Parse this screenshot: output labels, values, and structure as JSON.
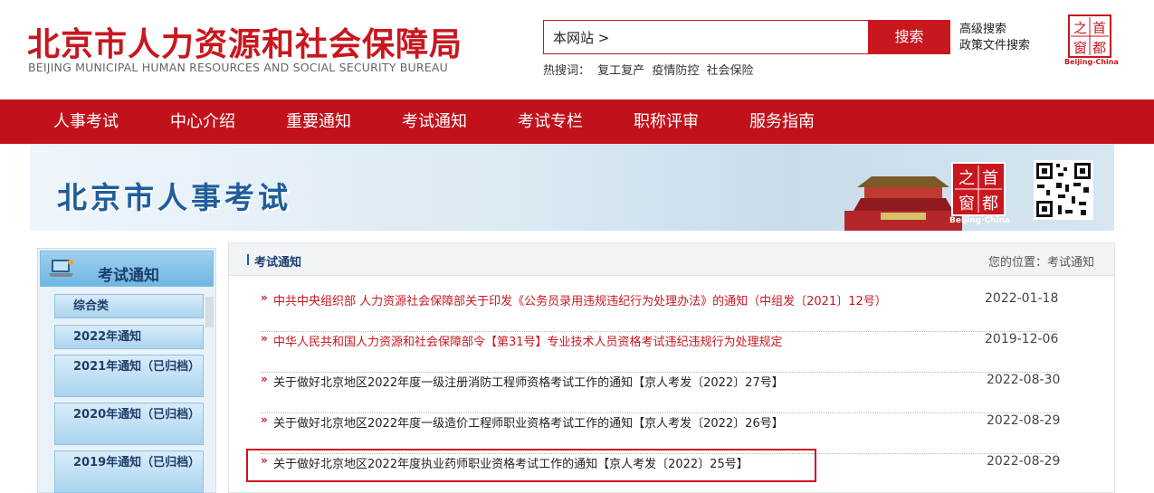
{
  "header": {
    "logo_cn": "北京市人力资源和社会保障局",
    "logo_en": "BEIJING MUNICIPAL HUMAN RESOURCES AND SOCIAL SECURITY BUREAU",
    "search_scope": "本网站 >",
    "search_button": "搜索",
    "advanced_search": "高级搜索",
    "policy_search": "政策文件搜索",
    "hot_label": "热搜词：",
    "hot_words": [
      "复工复产",
      "疫情防控",
      "社会保险"
    ],
    "seal_chars": [
      "之",
      "首",
      "窗",
      "都"
    ],
    "seal_caption": "Beijing-China"
  },
  "nav": {
    "items": [
      "人事考试",
      "中心介绍",
      "重要通知",
      "考试通知",
      "考试专栏",
      "职称评审",
      "服务指南"
    ]
  },
  "banner": {
    "title": "北京市人事考试",
    "seal_caption": "Beijing·China"
  },
  "sidebar": {
    "title": "考试通知",
    "items": [
      "综合类",
      "2022年通知",
      "2021年通知（已归档）",
      "2020年通知（已归档）",
      "2019年通知（已归档）"
    ]
  },
  "content": {
    "section_title": "考试通知",
    "breadcrumb": "您的位置：考试通知",
    "rows": [
      {
        "title": "中共中央组织部 人力资源社会保障部关于印发《公务员录用违规违纪行为处理办法》的通知（中组发〔2021〕12号）",
        "date": "2022-01-18",
        "important": true
      },
      {
        "title": "中华人民共和国人力资源和社会保障部令【第31号】专业技术人员资格考试违纪违规行为处理规定",
        "date": "2019-12-06",
        "important": true
      },
      {
        "title": "关于做好北京地区2022年度一级注册消防工程师资格考试工作的通知【京人考发〔2022〕27号】",
        "date": "2022-08-30",
        "important": false
      },
      {
        "title": "关于做好北京地区2022年度一级造价工程师职业资格考试工作的通知【京人考发〔2022〕26号】",
        "date": "2022-08-29",
        "important": false
      },
      {
        "title": "关于做好北京地区2022年度执业药师职业资格考试工作的通知【京人考发〔2022〕25号】",
        "date": "2022-08-29",
        "important": false
      }
    ],
    "arrow": "»"
  },
  "colors": {
    "brand_red": "#c1121c",
    "link_red": "#c8171e",
    "banner_blue": "#1f5d9b"
  }
}
